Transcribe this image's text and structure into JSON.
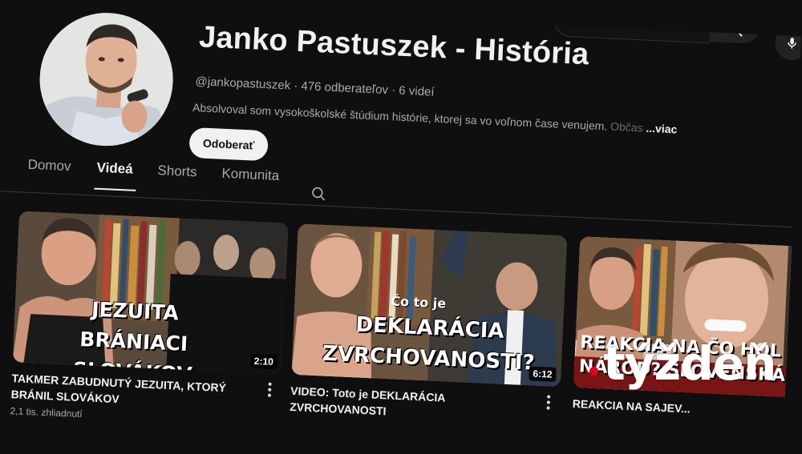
{
  "channel": {
    "name": "Janko Pastuszek - História",
    "handle": "@jankopastuszek",
    "subscribers": "476 odberateľov",
    "video_count": "6 videí",
    "description": "Absolvoval som vysokoškolské štúdium histórie, ktorej sa vo voľnom čase venujem.",
    "description_fade": "Občas",
    "more_label": "...viac",
    "subscribe_label": "Odoberať"
  },
  "tabs": [
    {
      "label": "Domov",
      "active": false
    },
    {
      "label": "Videá",
      "active": true
    },
    {
      "label": "Shorts",
      "active": false
    },
    {
      "label": "Komunita",
      "active": false
    }
  ],
  "videos": [
    {
      "overlay_lines": [
        "JEZUITA BRÁNIACI",
        "SLOVÁKOV"
      ],
      "duration": "2:10",
      "title": "TAKMER ZABUDNUTÝ JEZUITA, KTORÝ BRÁNIL SLOVÁKOV",
      "meta": "2,1 tis. zhliadnutí"
    },
    {
      "overlay_small": "Čo to je",
      "overlay_lines": [
        "DEKLARÁCIA",
        "ZVRCHOVANOSTI?"
      ],
      "duration": "6:12",
      "title": "VIDEO: Toto je DEKLARÁCIA ZVRCHOVANOSTI",
      "meta": ""
    },
    {
      "overlay_lines": [
        "REAKCIA NA ČO HOL",
        "NÁROD? SLOVENSKÁ ŠĽA"
      ],
      "duration": "",
      "title": "REAKCIA NA SAJEV...",
      "meta": ""
    }
  ],
  "watermark": {
    "text": "týždeň",
    "color": "#e3001b"
  },
  "icons": {
    "search": "search-icon",
    "mic": "mic-icon",
    "tab_search": "search-icon",
    "menu": "kebab-icon"
  }
}
